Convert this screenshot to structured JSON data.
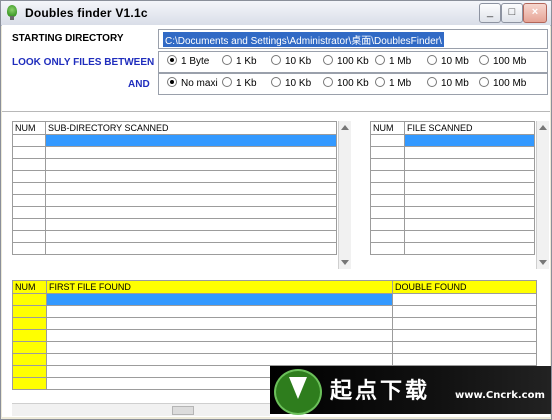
{
  "window": {
    "title": "Doubles finder  V1.1c",
    "controls": [
      "_",
      "□",
      "×"
    ]
  },
  "form": {
    "starting_directory_label": "STARTING DIRECTORY",
    "starting_directory_value": "C:\\Documents and Settings\\Administrator\\桌面\\DoublesFinder\\",
    "look_label": "LOOK ONLY FILES BETWEEN",
    "and_label": "AND",
    "min_options": [
      "1 Byte",
      "1 Kb",
      "10 Kb",
      "100 Kb",
      "1 Mb",
      "10 Mb",
      "100 Mb"
    ],
    "min_selected": "1 Byte",
    "max_options": [
      "No maxi",
      "1 Kb",
      "10 Kb",
      "100 Kb",
      "1 Mb",
      "10 Mb",
      "100 Mb"
    ],
    "max_selected": "No maxi"
  },
  "tables": {
    "subdirs": {
      "col_num": "NUM",
      "col_name": "SUB-DIRECTORY SCANNED"
    },
    "files": {
      "col_num": "NUM",
      "col_name": "FILE SCANNED"
    },
    "doubles": {
      "col_num": "NUM",
      "col_first": "FIRST FILE FOUND",
      "col_double": "DOUBLE FOUND"
    }
  },
  "watermark": {
    "text": "起点下载",
    "url": "www.Cncrk.com"
  }
}
